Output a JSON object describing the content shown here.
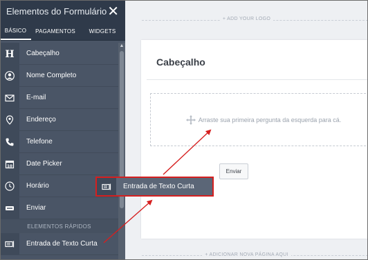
{
  "sidebar": {
    "title": "Elementos do Formulário",
    "tabs": [
      {
        "label": "BÁSICO",
        "active": true
      },
      {
        "label": "PAGAMENTOS",
        "active": false
      },
      {
        "label": "WIDGETS",
        "active": false
      }
    ],
    "items": [
      {
        "label": "Cabeçalho",
        "icon": "heading-icon"
      },
      {
        "label": "Nome Completo",
        "icon": "user-icon"
      },
      {
        "label": "E-mail",
        "icon": "envelope-icon"
      },
      {
        "label": "Endereço",
        "icon": "map-pin-icon"
      },
      {
        "label": "Telefone",
        "icon": "phone-icon"
      },
      {
        "label": "Date Picker",
        "icon": "calendar-icon"
      },
      {
        "label": "Horário",
        "icon": "clock-icon"
      },
      {
        "label": "Enviar",
        "icon": "send-icon"
      }
    ],
    "section_label": "ELEMENTOS RÁPIDOS",
    "quick_items": [
      {
        "label": "Entrada de Texto Curta",
        "icon": "short-text-icon"
      }
    ]
  },
  "canvas": {
    "add_logo": "+ ADD YOUR LOGO",
    "form_title": "Cabeçalho",
    "dropzone_text": "Arraste sua primeira pergunta da esquerda para cá.",
    "submit_label": "Enviar",
    "add_page": "+ ADICIONAR NOVA PÁGINA AQUI"
  },
  "dragged": {
    "label": "Entrada de Texto Curta",
    "icon": "short-text-icon"
  },
  "colors": {
    "sidebar_bg": "#4a5566",
    "header_bg": "#2f3a4a",
    "highlight": "#d61f1f"
  }
}
